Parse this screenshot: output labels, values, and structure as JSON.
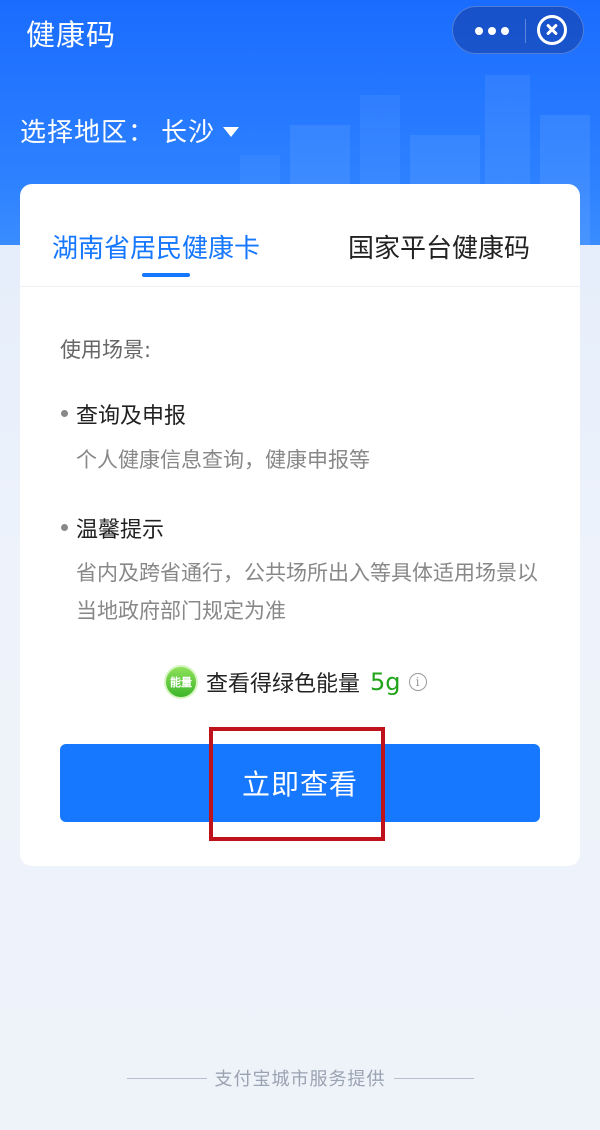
{
  "app": {
    "title": "健康码",
    "more_icon": "more-dots-icon",
    "close_icon": "close-circle-icon"
  },
  "region": {
    "label": "选择地区：",
    "value": "长沙"
  },
  "tabs": [
    {
      "label": "湖南省居民健康卡",
      "active": true
    },
    {
      "label": "国家平台健康码",
      "active": false
    }
  ],
  "content": {
    "section_label": "使用场景:",
    "items": [
      {
        "title": "查询及申报",
        "desc": "个人健康信息查询，健康申报等"
      },
      {
        "title": "温馨提示",
        "desc": "省内及跨省通行，公共场所出入等具体适用场景以当地政府部门规定为准"
      }
    ],
    "energy": {
      "icon_text": "能量",
      "label": "查看得绿色能量",
      "amount": "5g"
    },
    "primary_button": "立即查看"
  },
  "footer": {
    "text": "支付宝城市服务提供"
  },
  "colors": {
    "accent": "#1677ff",
    "energy_green": "#21a41a",
    "highlight_red": "#c0121a"
  }
}
